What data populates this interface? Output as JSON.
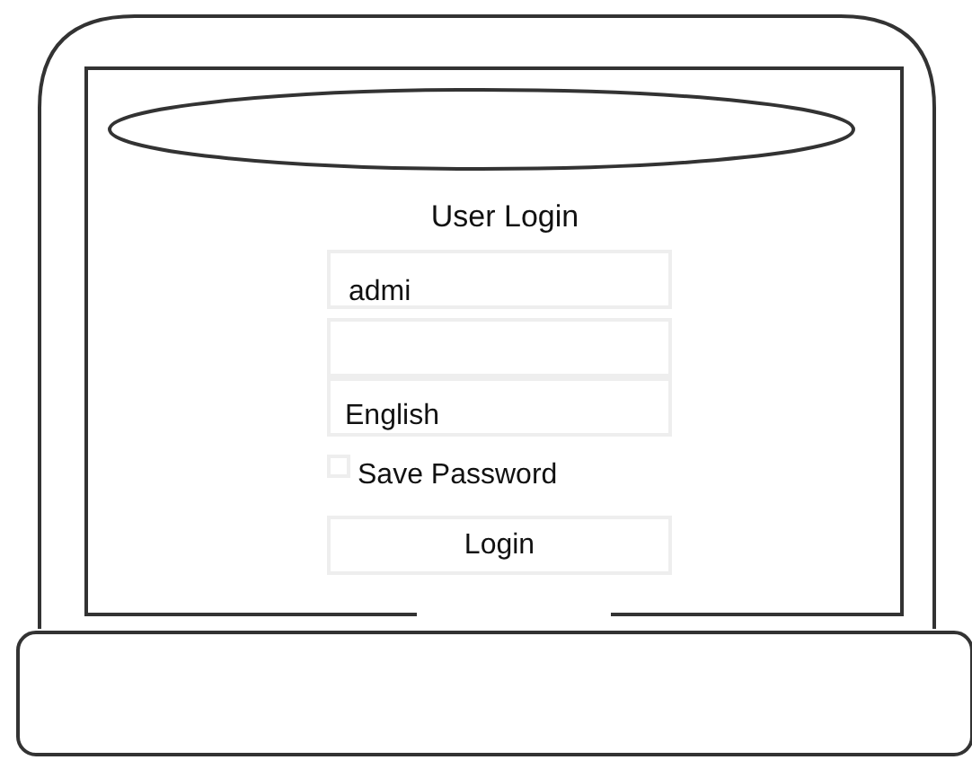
{
  "form": {
    "title": "User Login",
    "username": {
      "value": "admi"
    },
    "language": {
      "value": "English"
    },
    "save_password": {
      "label": "Save Password",
      "checked": false
    },
    "login_button": {
      "label": "Login"
    }
  }
}
